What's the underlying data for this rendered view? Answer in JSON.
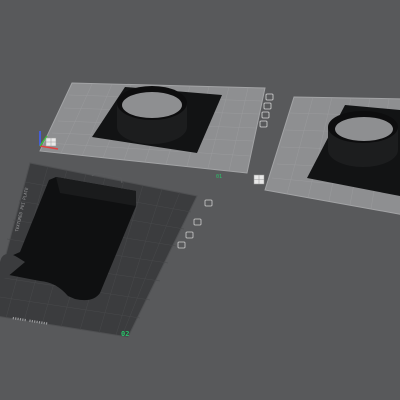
{
  "viewport": {
    "background_color": "#58595b",
    "plates": [
      {
        "id": "plate-1",
        "surface": "light-grey-grid",
        "plate_color": "#8e8f91",
        "object": "square-base-with-ring"
      },
      {
        "id": "plate-2",
        "surface": "light-grey-grid",
        "plate_color": "#8e8f91",
        "object": "square-base-with-ring"
      },
      {
        "id": "plate-3",
        "surface": "textured-pei-dark",
        "plate_color": "#3b3c3e",
        "object": "flat-tray-with-tabs",
        "number_label": "02",
        "bed_label": "TEXTURED PEI PLATE"
      }
    ],
    "plate_number_color": "#29c46a",
    "axis_colors": {
      "x": "#e04040",
      "y": "#3fbf3f",
      "z": "#4060ff"
    },
    "plate_icons": [
      "lock-icon",
      "settings-icon",
      "arrange-icon",
      "orient-icon"
    ]
  }
}
